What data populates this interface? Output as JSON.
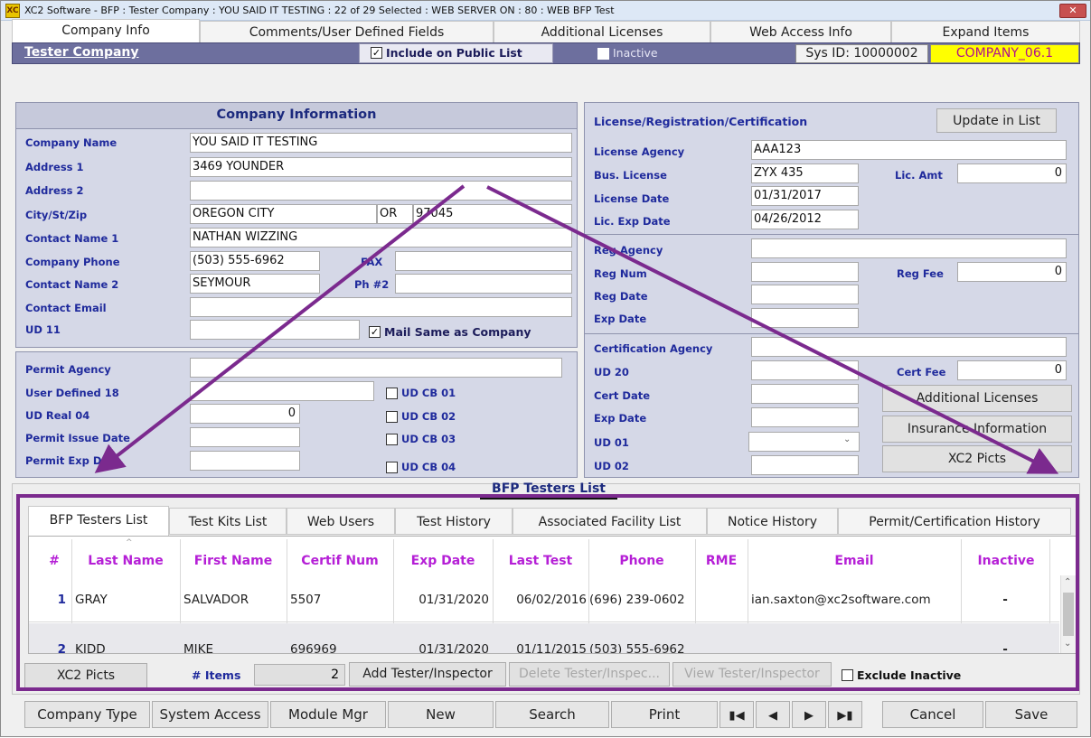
{
  "window": {
    "title": "XC2 Software - BFP : Tester Company : YOU SAID IT TESTING : 22 of 29 Selected : WEB SERVER ON : 80 : WEB BFP Test",
    "app_icon_text": "XC",
    "close_label": "✕"
  },
  "tabs": [
    "Company Info",
    "Comments/User Defined Fields",
    "Additional Licenses",
    "Web Access Info",
    "Expand Items"
  ],
  "header": {
    "company_link": "Tester Company",
    "include_public": "Include on Public List",
    "inactive": "Inactive",
    "sys_id": "Sys ID:  10000002",
    "company_code": "COMPANY_06.1"
  },
  "company_info": {
    "heading": "Company Information",
    "company_name_label": "Company Name",
    "company_name": "YOU SAID IT TESTING",
    "address1_label": "Address 1",
    "address1": "3469  YOUNDER",
    "address2_label": "Address 2",
    "address2": "",
    "city_label": "City/St/Zip",
    "city": "OREGON CITY",
    "state": "OR",
    "zip": "97045",
    "contact1_label": "Contact Name 1",
    "contact1": "NATHAN WIZZING",
    "phone_label": "Company Phone",
    "phone": "(503) 555-6962",
    "fax_label": "FAX",
    "fax": "",
    "contact2_label": "Contact Name 2",
    "contact2": "SEYMOUR",
    "ph2_label": "Ph #2",
    "ph2": "",
    "email_label": "Contact Email",
    "email": "",
    "ud11_label": "UD 11",
    "ud11": "",
    "mail_same": "Mail Same as Company"
  },
  "permit": {
    "agency_label": "Permit Agency",
    "agency": "",
    "ud18_label": "User Defined 18",
    "ud18": "",
    "udreal_label": "UD Real 04",
    "udreal": "0",
    "issue_label": "Permit Issue Date",
    "issue": "",
    "exp_label": "Permit Exp Date",
    "exp": "",
    "cb1": "UD CB 01",
    "cb2": "UD CB 02",
    "cb3": "UD CB 03",
    "cb4": "UD CB 04"
  },
  "license": {
    "heading": "License/Registration/Certification",
    "update_btn": "Update in List",
    "agency_label": "License Agency",
    "agency": "AAA123",
    "bus_label": "Bus. License",
    "bus": "ZYX 435",
    "lic_amt_label": "Lic. Amt",
    "lic_amt": "0",
    "date_label": "License Date",
    "date": "01/31/2017",
    "exp_label": "Lic. Exp Date",
    "exp": "04/26/2012",
    "reg_agency_label": "Reg Agency",
    "reg_agency": "",
    "reg_num_label": "Reg Num",
    "reg_num": "",
    "reg_fee_label": "Reg Fee",
    "reg_fee": "0",
    "reg_date_label": "Reg Date",
    "reg_date": "",
    "reg_exp_label": "Exp Date",
    "reg_exp": "",
    "cert_agency_label": "Certification Agency",
    "cert_agency": "",
    "ud20_label": "UD 20",
    "ud20": "",
    "cert_fee_label": "Cert Fee",
    "cert_fee": "0",
    "cert_date_label": "Cert Date",
    "cert_date": "",
    "cert_exp_label": "Exp Date",
    "cert_exp": "",
    "ud01_label": "UD 01",
    "ud01": "",
    "ud02_label": "UD 02",
    "ud02": "",
    "addl_btn": "Additional Licenses",
    "ins_btn": "Insurance Information",
    "picts_btn": "XC2 Picts"
  },
  "testers": {
    "heading": "BFP Testers List",
    "subtabs": [
      "BFP Testers List",
      "Test Kits List",
      "Web Users",
      "Test History",
      "Associated Facility List",
      "Notice History",
      "Permit/Certification History"
    ],
    "columns": [
      "#",
      "Last Name",
      "First Name",
      "Certif Num",
      "Exp Date",
      "Last Test",
      "Phone",
      "RME",
      "Email",
      "Inactive"
    ],
    "rows": [
      {
        "num": "1",
        "last": "GRAY",
        "first": "SALVADOR",
        "cert": "5507",
        "exp": "01/31/2020",
        "last_test": "06/02/2016",
        "phone": "(696) 239-0602",
        "rme": "",
        "email": "ian.saxton@xc2software.com",
        "inactive": "-"
      },
      {
        "num": "2",
        "last": "KIDD",
        "first": "MIKE",
        "cert": "696969",
        "exp": "01/31/2020",
        "last_test": "01/11/2015",
        "phone": "(503) 555-6962",
        "rme": "",
        "email": "",
        "inactive": "-"
      }
    ]
  },
  "list_footer": {
    "picts": "XC2 Picts",
    "items_label": "# Items",
    "items_count": "2",
    "add": "Add Tester/Inspector",
    "delete": "Delete Tester/Inspec...",
    "view": "View Tester/Inspector",
    "exclude": "Exclude Inactive"
  },
  "bottom": {
    "company_type": "Company Type",
    "system_access": "System Access",
    "module_mgr": "Module Mgr",
    "new": "New",
    "search": "Search",
    "print": "Print",
    "first_icon": "first-record-icon",
    "prev_icon": "previous-record-icon",
    "next_icon": "next-record-icon",
    "last_icon": "last-record-icon",
    "cancel": "Cancel",
    "save": "Save"
  },
  "colors": {
    "annotation": "#7b2a8e",
    "company_code_bg": "#ffff00",
    "header_strip": "#6d6f9e",
    "panel": "#d5d8e7",
    "label": "#1f2a9c",
    "column_header": "#b51fd6"
  }
}
